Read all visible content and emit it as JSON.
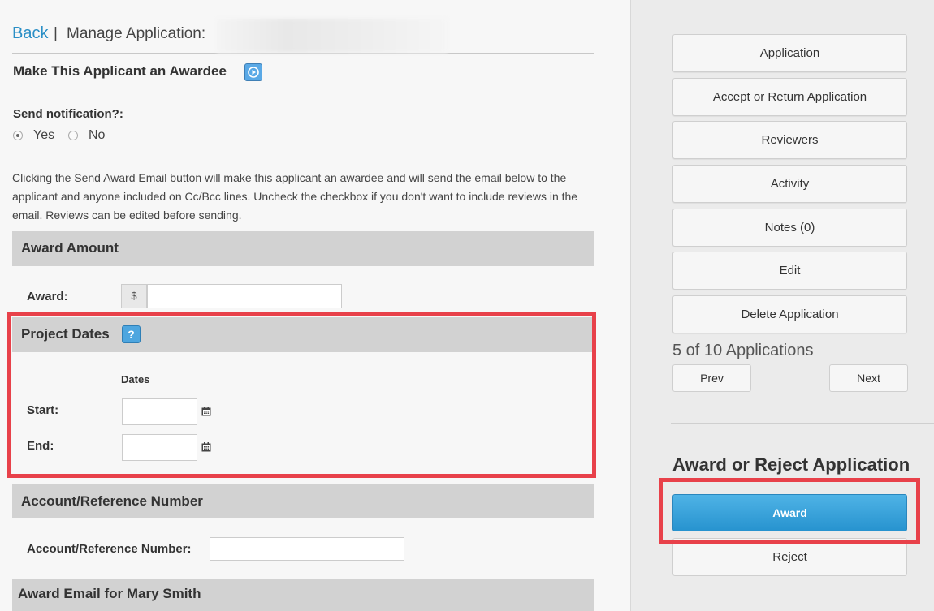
{
  "header": {
    "back_label": "Back",
    "separator": "|",
    "title": "Manage Application:"
  },
  "award_section": {
    "heading": "Make This Applicant an Awardee",
    "notification_label": "Send notification?:",
    "yes_label": "Yes",
    "no_label": "No",
    "selected": "Yes",
    "description": "Clicking the Send Award Email button will make this applicant an awardee and will send the email below to the applicant and anyone included on Cc/Bcc lines. Uncheck the checkbox if you don't want to include reviews in the email. Reviews can be edited before sending."
  },
  "award_amount": {
    "title": "Award Amount",
    "label": "Award:",
    "currency": "$",
    "value": ""
  },
  "project_dates": {
    "title": "Project Dates",
    "help": "?",
    "column_label": "Dates",
    "start_label": "Start:",
    "end_label": "End:",
    "start_value": "",
    "end_value": ""
  },
  "account": {
    "title": "Account/Reference Number",
    "label": "Account/Reference Number:",
    "value": ""
  },
  "email_section": {
    "title": "Award Email for Mary Smith"
  },
  "sidebar": {
    "buttons": [
      "Application",
      "Accept or Return Application",
      "Reviewers",
      "Activity",
      "Notes (0)",
      "Edit",
      "Delete Application"
    ],
    "count_text": "5 of 10 Applications",
    "prev_label": "Prev",
    "next_label": "Next",
    "decision_heading": "Award or Reject Application",
    "award_label": "Award",
    "reject_label": "Reject"
  },
  "colors": {
    "link": "#2b8fc6",
    "award_button": "#2793cf",
    "highlight": "#e8414a",
    "section_bar": "#d2d2d2"
  }
}
